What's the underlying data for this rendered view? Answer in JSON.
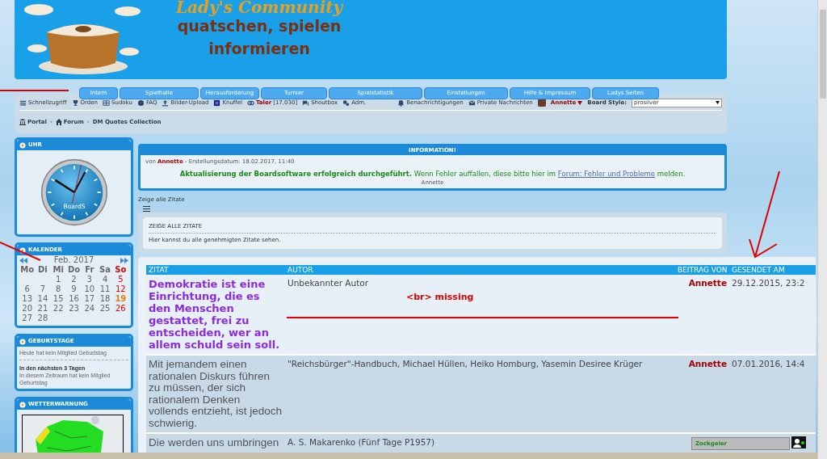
{
  "header": {
    "title": "Lady's Community",
    "slogan": [
      "quatschen, spielen",
      "informieren"
    ]
  },
  "nav_tabs": [
    "Intern",
    "Spielhalle",
    "Herausforderung",
    "Turnier",
    "Spielstatistik",
    "Einstellungen",
    "Hilfe & Impressum",
    "Ladys Seiten"
  ],
  "toolbar": {
    "left": [
      {
        "label": "Schnellzugriff"
      },
      {
        "label": "Orden"
      },
      {
        "label": "Sudoku"
      },
      {
        "label": "FAQ"
      },
      {
        "label": "Bilder-Upload"
      },
      {
        "label": "Knuffel"
      },
      {
        "label": "Taler",
        "count": "[17,030]"
      },
      {
        "label": "Shoutbox"
      },
      {
        "label": "Adm."
      }
    ],
    "right": [
      {
        "label": "Benachrichtigungen"
      },
      {
        "label": "Private Nachrichten"
      }
    ],
    "user": "Annette",
    "board_style": {
      "label": "Board Style:",
      "value": "prosilver"
    }
  },
  "breadcrumbs": {
    "separator": "‹",
    "items": [
      "Portal",
      "Forum",
      "DM Quotes Collection"
    ]
  },
  "sidebar": {
    "clock": {
      "title": "UHR",
      "brand": "BoardS"
    },
    "calendar": {
      "title": "KALENDER",
      "month": "Feb. 2017",
      "weekdays": [
        "Mo",
        "Di",
        "Mi",
        "Do",
        "Fr",
        "Sa",
        "So"
      ],
      "weeks": [
        [
          {
            "d": "1",
            "today": false
          },
          {
            "d": "2",
            "today": false
          },
          {
            "d": "3",
            "today": false
          },
          {
            "d": "4",
            "today": false
          },
          {
            "d": "5",
            "today": false
          }
        ],
        [
          {
            "d": "6",
            "today": false
          },
          {
            "d": "7",
            "today": false
          },
          {
            "d": "8",
            "today": false
          },
          {
            "d": "9",
            "today": false
          },
          {
            "d": "10",
            "today": false
          },
          {
            "d": "11",
            "today": false
          },
          {
            "d": "12",
            "today": false
          }
        ],
        [
          {
            "d": "13",
            "today": false
          },
          {
            "d": "14",
            "today": false
          },
          {
            "d": "15",
            "today": false
          },
          {
            "d": "16",
            "today": false
          },
          {
            "d": "17",
            "today": false
          },
          {
            "d": "18",
            "today": false
          },
          {
            "d": "19",
            "today": true
          }
        ],
        [
          {
            "d": "20",
            "today": false
          },
          {
            "d": "21",
            "today": false
          },
          {
            "d": "22",
            "today": false
          },
          {
            "d": "23",
            "today": false
          },
          {
            "d": "24",
            "today": false
          },
          {
            "d": "25",
            "today": false
          },
          {
            "d": "26",
            "today": false
          }
        ],
        [
          {
            "d": "27",
            "today": false
          },
          {
            "d": "28",
            "today": false
          }
        ]
      ]
    },
    "birthdays": {
      "title": "GEBURTSTAGE",
      "today": "Heute hat kein Mitglied Geburtstag",
      "next_heading": "In den nächsten 3 Tagen",
      "next_text": "In diesem Zeitraum hat kein Mitglied Geburtstag"
    },
    "weather": {
      "title": "WETTERWARNUNG"
    }
  },
  "info": {
    "title": "INFORMATION!",
    "by": "von",
    "author": "Annette",
    "date": "- Erstellungsdatum: 18.02.2017, 11:40",
    "headline": "Aktualisierung der Boardsoftware erfolgreich durchgeführt.",
    "text": "Wenn Fehler auffallen, diese bitte hier im",
    "link": "Forum: Fehler und Probleme",
    "text_end": "melden.",
    "signature": "Annette"
  },
  "page_link": "Zeige alle Zitate",
  "intro": {
    "title": "ZEIGE ALLE ZITATE",
    "text": "Hier kannst du alle genehmigten Zitate sehen."
  },
  "table": {
    "columns": [
      "ZITAT",
      "AUTOR",
      "BEITRAG VON",
      "GESENDET AM"
    ],
    "rows": [
      {
        "kind": "highlight",
        "quote": "Demokratie ist eine Einrichtung, die es den Menschen gestattet, frei zu entscheiden, wer an allem schuld sein soll.",
        "author": "Unbekannter Autor",
        "poster": "Annette",
        "date": "29.12.2015, 23:2"
      },
      {
        "kind": "normal",
        "quote": "Mit jemandem einen rationalen Diskurs führen zu müssen, der sich rationalem Denken vollends entzieht, ist jedoch schwierig.",
        "author": "\"Reichsbürger\"-Handbuch, Michael Hüllen, Heiko Homburg, Yasemin Desiree Krüger",
        "poster": "Annette",
        "date": "07.01.2016, 14:4"
      },
      {
        "kind": "normal",
        "quote": "Die werden uns umbringen",
        "author": "A. S. Makarenko (Fünf Tage P1957)"
      }
    ]
  },
  "annotation": "<br> missing",
  "widget": {
    "label": "Zockgeier"
  }
}
